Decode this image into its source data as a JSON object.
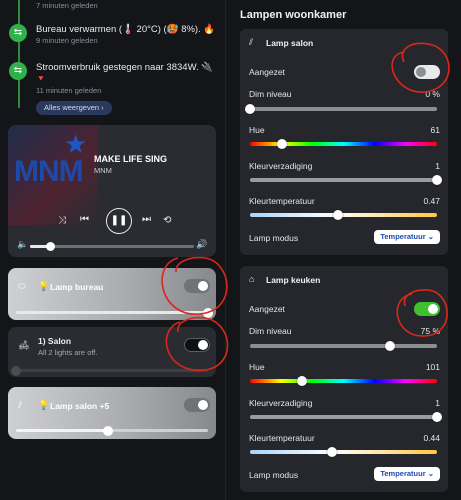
{
  "timeline": {
    "items": [
      {
        "title": "",
        "time": "7 minuten geleden"
      },
      {
        "title": "Bureau verwarmen (🌡️ 20°C) (🥵 8%). 🔥",
        "time": "9 minuten geleden"
      },
      {
        "title": "Stroomverbruik gestegen naar 3834W. 🔌",
        "title2": "🔻",
        "time": "11 minuten geleden"
      }
    ],
    "show_all": "Alles weergeven ›"
  },
  "media": {
    "title": "MAKE LIFE SING",
    "subtitle": "MNM",
    "logo_text": "MNM",
    "volume": 0.12
  },
  "left_lights": [
    {
      "name": "Lamp bureau",
      "sub": "",
      "on": true,
      "level": 1.0
    },
    {
      "name": "1) Salon",
      "sub": "All 2 lights are off.",
      "on": false,
      "level": 0.0
    },
    {
      "name": "Lamp salon +5",
      "sub": "",
      "on": true,
      "level": 0.48
    }
  ],
  "right": {
    "header": "Lampen woonkamer",
    "panels": [
      {
        "title": "Lamp salon",
        "on_label": "Aangezet",
        "on": false,
        "dim_label": "Dim niveau",
        "dim_value": "0 %",
        "dim": 0.0,
        "hue_label": "Hue",
        "hue_value": "61",
        "hue": 0.17,
        "sat_label": "Kleurverzadiging",
        "sat_value": "1",
        "sat": 1.0,
        "temp_label": "Kleurtemperatuur",
        "temp_value": "0.47",
        "temp": 0.47,
        "mode_label": "Lamp modus",
        "mode_value": "Temperatuur ⌄"
      },
      {
        "title": "Lamp keuken",
        "on_label": "Aangezet",
        "on": true,
        "dim_label": "Dim niveau",
        "dim_value": "75 %",
        "dim": 0.75,
        "hue_label": "Hue",
        "hue_value": "101",
        "hue": 0.28,
        "sat_label": "Kleurverzadiging",
        "sat_value": "1",
        "sat": 1.0,
        "temp_label": "Kleurtemperatuur",
        "temp_value": "0.44",
        "temp": 0.44,
        "mode_label": "Lamp modus",
        "mode_value": "Temperatuur ⌄"
      }
    ]
  },
  "colors": {
    "accent_green": "#2fb24a",
    "toggle_on": "#3ec02f",
    "annotation": "#d8281c"
  }
}
